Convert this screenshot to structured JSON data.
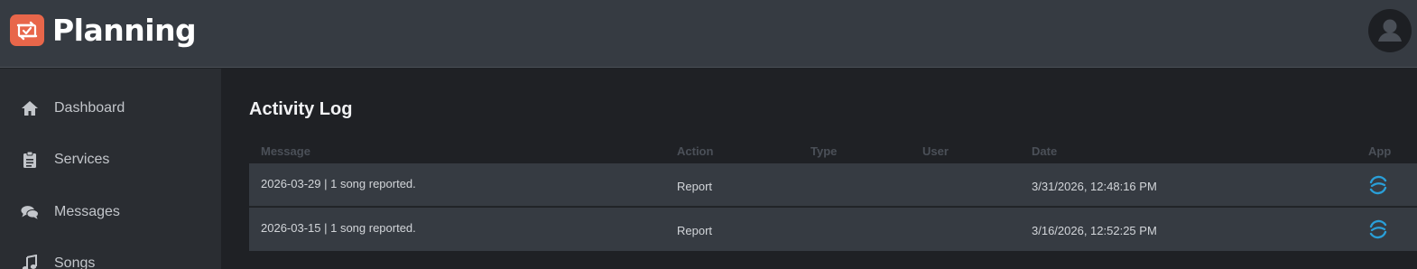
{
  "header": {
    "app_title": "Planning",
    "logo_icon": "calendar-check-icon",
    "avatar_icon": "user-avatar-icon",
    "brand_color": "#e8664a"
  },
  "sidebar": {
    "items": [
      {
        "label": "Dashboard",
        "icon": "home-icon"
      },
      {
        "label": "Services",
        "icon": "clipboard-icon"
      },
      {
        "label": "Messages",
        "icon": "chat-bubbles-icon"
      },
      {
        "label": "Songs",
        "icon": "music-note-icon"
      }
    ]
  },
  "main": {
    "title": "Activity Log",
    "columns": [
      "Message",
      "Action",
      "Type",
      "User",
      "Date",
      "App"
    ],
    "rows": [
      {
        "message": "2026-03-29 | 1 song reported.",
        "action": "Report",
        "type": "",
        "user": "",
        "date": "3/31/2026, 12:48:16 PM",
        "app_icon": "ccli-sync-icon"
      },
      {
        "message": "2026-03-15 | 1 song reported.",
        "action": "Report",
        "type": "",
        "user": "",
        "date": "3/16/2026, 12:52:25 PM",
        "app_icon": "ccli-sync-icon"
      }
    ]
  }
}
